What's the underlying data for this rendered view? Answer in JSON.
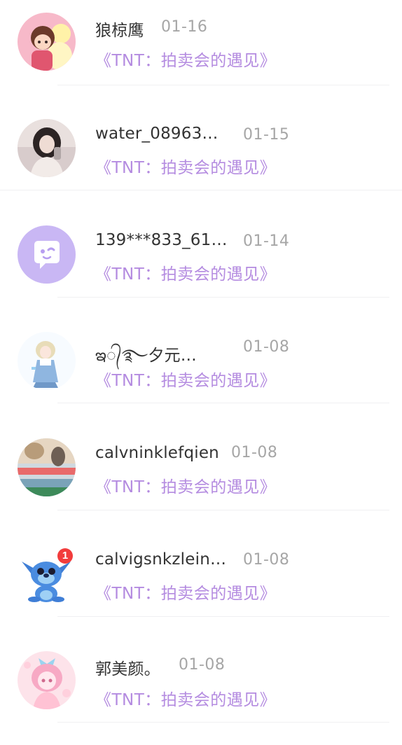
{
  "messages": [
    {
      "name": "狼椋鹰",
      "date": "01-16",
      "subtitle": "《TNT：拍卖会的遇见》",
      "avatar": "cartoon-couple-avatar"
    },
    {
      "name": "water_08963…",
      "date": "01-15",
      "subtitle": "《TNT：拍卖会的遇见》",
      "avatar": "girl-selfie-avatar"
    },
    {
      "name": "139***833_61…",
      "date": "01-14",
      "subtitle": "《TNT：拍卖会的遇见》",
      "avatar": "default-chat-bubble-avatar"
    },
    {
      "name": "ఇ᭄࿐夕元…",
      "date": "01-08",
      "subtitle": "《TNT：拍卖会的遇见》",
      "avatar": "anime-girl-avatar"
    },
    {
      "name": "calvninklefqien",
      "date": "01-08",
      "subtitle": "《TNT：拍卖会的遇见》",
      "avatar": "scenery-photo-avatar"
    },
    {
      "name": "calvigsnkzlein…",
      "date": "01-08",
      "subtitle": "《TNT：拍卖会的遇见》",
      "avatar": "stitch-cartoon-avatar",
      "badge": "1"
    },
    {
      "name": "郭美颜。",
      "date": "01-08",
      "subtitle": "《TNT：拍卖会的遇见》",
      "avatar": "pink-anime-girl-avatar"
    }
  ],
  "colors": {
    "name": "#333333",
    "date": "#a6a6a6",
    "subtitle": "#b48be0",
    "default_avatar_bg": "#c7b6f2",
    "badge": "#f23c3c"
  }
}
